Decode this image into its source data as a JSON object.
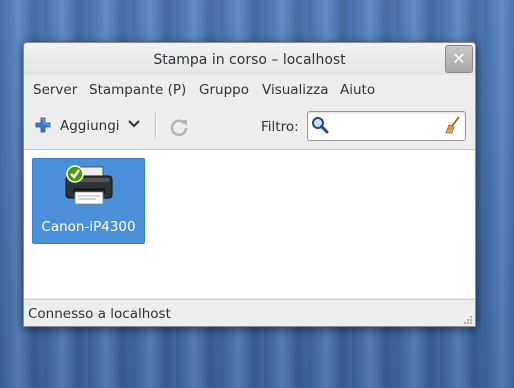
{
  "window": {
    "title": "Stampa in corso – localhost",
    "close_glyph": "✕"
  },
  "menubar": {
    "items": [
      "Server",
      "Stampante (P)",
      "Gruppo",
      "Visualizza",
      "Aiuto"
    ]
  },
  "toolbar": {
    "add_label": "Aggiungi",
    "filter_label": "Filtro:",
    "filter_value": "",
    "icons": [
      "plus-icon",
      "chevron-down-icon",
      "refresh-icon",
      "search-icon",
      "clear-icon"
    ]
  },
  "printers": [
    {
      "name": "Canon-iP4300",
      "status": "default-checkmark",
      "selected": true
    }
  ],
  "statusbar": {
    "text": "Connesso a localhost"
  },
  "colors": {
    "selection": "#4a90d9",
    "add_plus": "#3d7ac4",
    "check": "#4e9a06",
    "desktop": "#4a78b8"
  }
}
